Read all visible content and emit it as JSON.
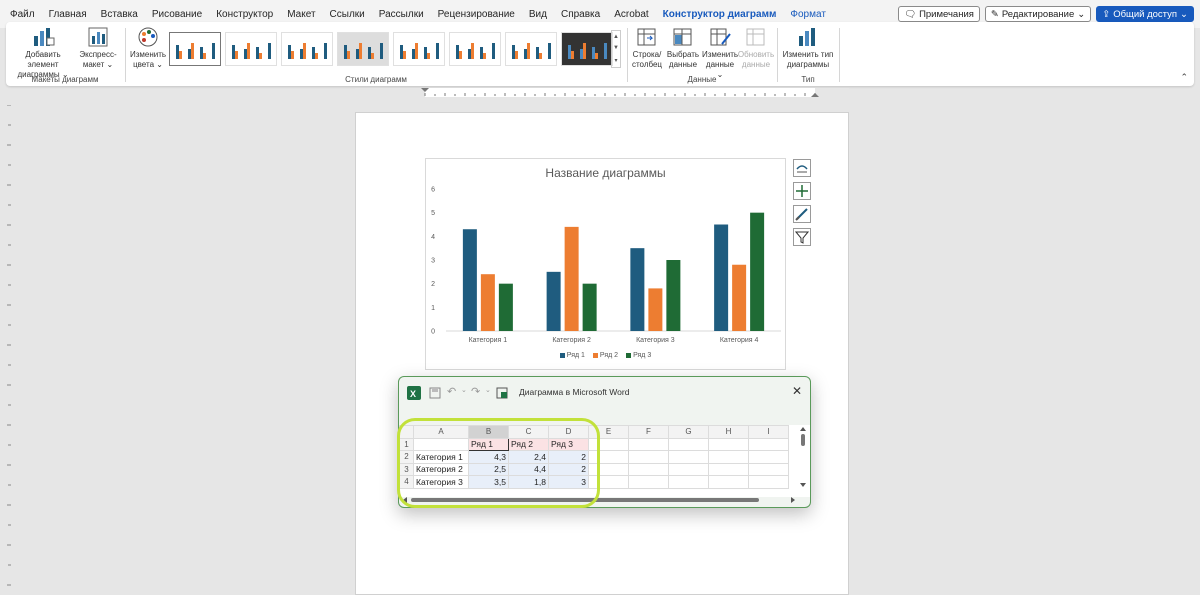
{
  "menu": {
    "tabs": [
      "Файл",
      "Главная",
      "Вставка",
      "Рисование",
      "Конструктор",
      "Макет",
      "Ссылки",
      "Рассылки",
      "Рецензирование",
      "Вид",
      "Справка",
      "Acrobat"
    ],
    "active_tab": "Конструктор диаграмм",
    "format_tab": "Формат",
    "comments": "Примечания",
    "editing": "Редактирование",
    "share": "Общий доступ"
  },
  "ribbon": {
    "add_element": [
      "Добавить элемент",
      "диаграммы ⌄"
    ],
    "quick_layout": [
      "Экспресс-",
      "макет ⌄"
    ],
    "change_colors": [
      "Изменить",
      "цвета ⌄"
    ],
    "group_layouts": "Макеты диаграмм",
    "group_styles": "Стили диаграмм",
    "switch_row_col": [
      "Строка/",
      "столбец"
    ],
    "select_data": [
      "Выбрать",
      "данные"
    ],
    "edit_data": [
      "Изменить",
      "данные ⌄"
    ],
    "refresh_data": [
      "Обновить",
      "данные"
    ],
    "group_data": "Данные",
    "change_type": [
      "Изменить тип",
      "диаграммы"
    ],
    "group_type": "Тип"
  },
  "colors": {
    "series1": "#1f5c7f",
    "series2": "#ed7d31",
    "series3": "#1f6b35",
    "accent": "#185abd",
    "highlight": "#c2e13a"
  },
  "chart_data": {
    "type": "bar",
    "title": "Название диаграммы",
    "categories": [
      "Категория 1",
      "Категория 2",
      "Категория 3",
      "Категория 4"
    ],
    "series": [
      {
        "name": "Ряд 1",
        "values": [
          4.3,
          2.5,
          3.5,
          4.5
        ]
      },
      {
        "name": "Ряд 2",
        "values": [
          2.4,
          4.4,
          1.8,
          2.8
        ]
      },
      {
        "name": "Ряд 3",
        "values": [
          2,
          2,
          3,
          5
        ]
      }
    ],
    "ylim": [
      0,
      6
    ],
    "yticks": [
      "0",
      "1",
      "2",
      "3",
      "4",
      "5",
      "6"
    ],
    "grid": false,
    "legend": "bottom"
  },
  "excel": {
    "title": "Диаграмма в Microsoft Word",
    "columns": [
      "A",
      "B",
      "C",
      "D",
      "E",
      "F",
      "G",
      "H",
      "I"
    ],
    "rows": [
      {
        "n": "1",
        "a": "",
        "b": "Ряд 1",
        "c": "Ряд 2",
        "d": "Ряд 3"
      },
      {
        "n": "2",
        "a": "Категория 1",
        "b": "4,3",
        "c": "2,4",
        "d": "2"
      },
      {
        "n": "3",
        "a": "Категория 2",
        "b": "2,5",
        "c": "4,4",
        "d": "2"
      },
      {
        "n": "4",
        "a": "Категория 3",
        "b": "3,5",
        "c": "1,8",
        "d": "3"
      }
    ]
  }
}
